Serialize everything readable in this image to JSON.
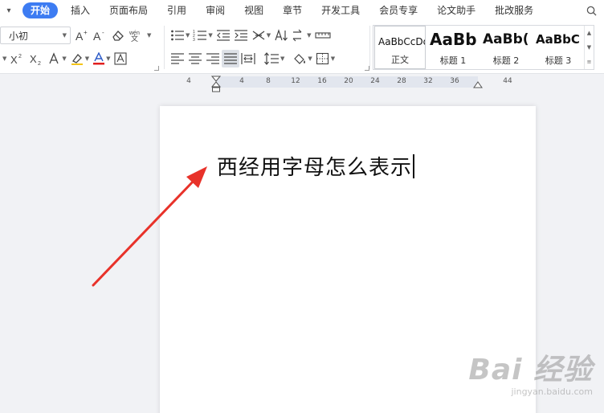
{
  "menu": {
    "tabs": [
      "开始",
      "插入",
      "页面布局",
      "引用",
      "审阅",
      "视图",
      "章节",
      "开发工具",
      "会员专享",
      "论文助手",
      "批改服务"
    ],
    "active_tab": "开始",
    "search_label": "Q"
  },
  "ribbon": {
    "font_size_value": "小初",
    "styles": [
      {
        "sample": "AaBbCcDd",
        "name": "正文"
      },
      {
        "sample": "AaBb",
        "name": "标题 1"
      },
      {
        "sample": "AaBb(",
        "name": "标题 2"
      },
      {
        "sample": "AaBbC",
        "name": "标题 3"
      }
    ]
  },
  "ruler": {
    "labels": [
      "4",
      "4",
      "8",
      "12",
      "16",
      "20",
      "24",
      "28",
      "32",
      "36",
      "44"
    ]
  },
  "document": {
    "text": "西经用字母怎么表示"
  },
  "watermark": {
    "logo": "Bai 经验",
    "url": "jingyan.baidu.com"
  },
  "colors": {
    "accent": "#3d7cf2",
    "arrow": "#e8322a",
    "font_color_bar": "#e02020"
  }
}
